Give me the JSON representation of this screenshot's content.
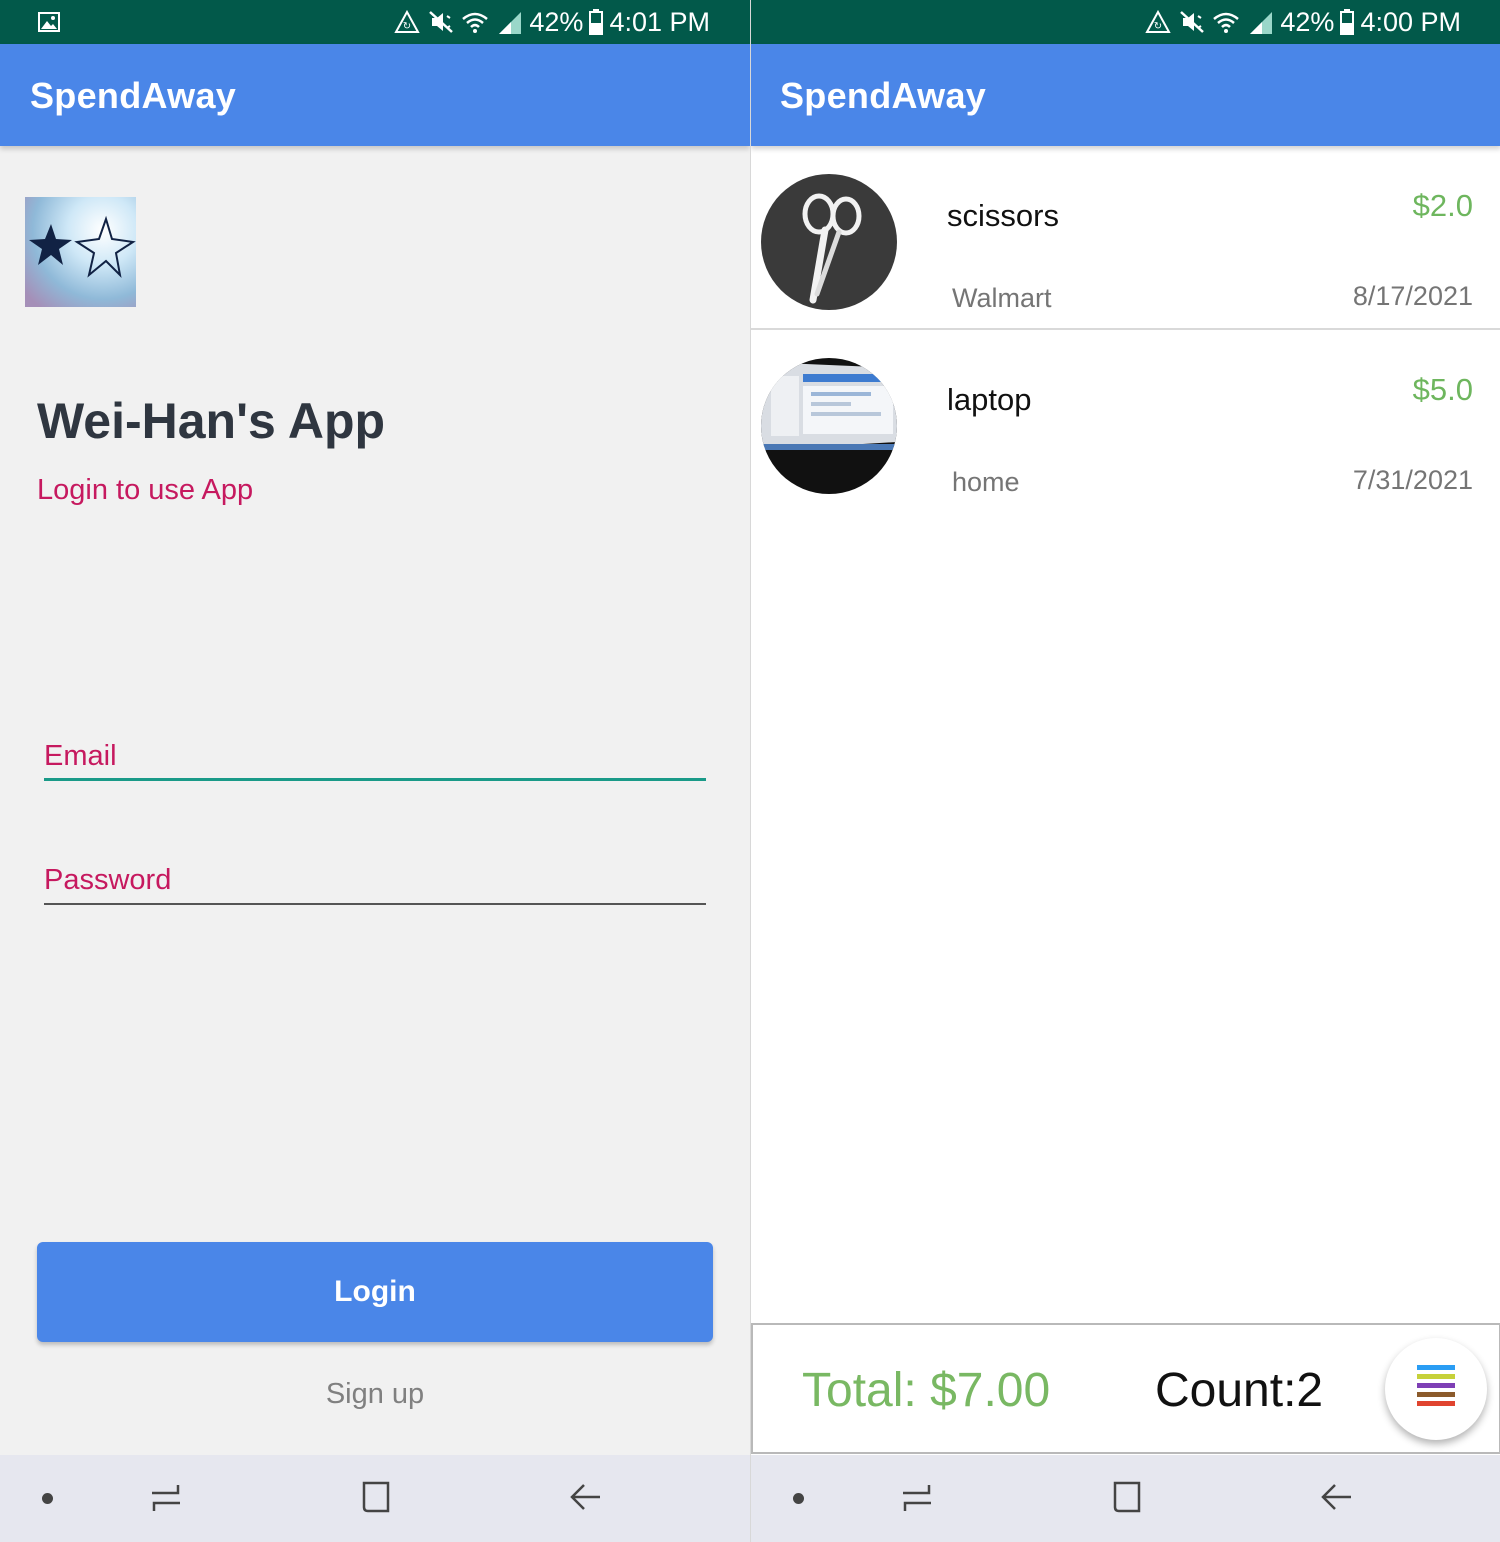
{
  "left": {
    "status": {
      "battery": "42%",
      "time": "4:01 PM"
    },
    "appbar": {
      "title": "SpendAway"
    },
    "welcome": "Wei-Han's App",
    "subtitle": "Login to use App",
    "email": {
      "placeholder": "Email",
      "value": ""
    },
    "password": {
      "placeholder": "Password",
      "value": ""
    },
    "login_label": "Login",
    "signup_label": "Sign up"
  },
  "right": {
    "status": {
      "battery": "42%",
      "time": "4:00 PM"
    },
    "appbar": {
      "title": "SpendAway"
    },
    "items": [
      {
        "name": "scissors",
        "price": "$2.0",
        "store": "Walmart",
        "date": "8/17/2021",
        "thumb_icon": "scissors-photo"
      },
      {
        "name": "laptop",
        "price": "$5.0",
        "store": "home",
        "date": "7/31/2021",
        "thumb_icon": "laptop-photo"
      }
    ],
    "footer": {
      "total": "Total: $7.00",
      "count": "Count:2"
    }
  },
  "colors": {
    "status_bar": "#02594a",
    "app_bar": "#4a86e8",
    "accent_pink": "#c6195f",
    "accent_teal": "#1a9a88",
    "price_green": "#6eb65e",
    "fab_stripes": [
      "#2a9df4",
      "#c6d13a",
      "#7e3fb5",
      "#8b5a2b",
      "#e0442f"
    ]
  }
}
